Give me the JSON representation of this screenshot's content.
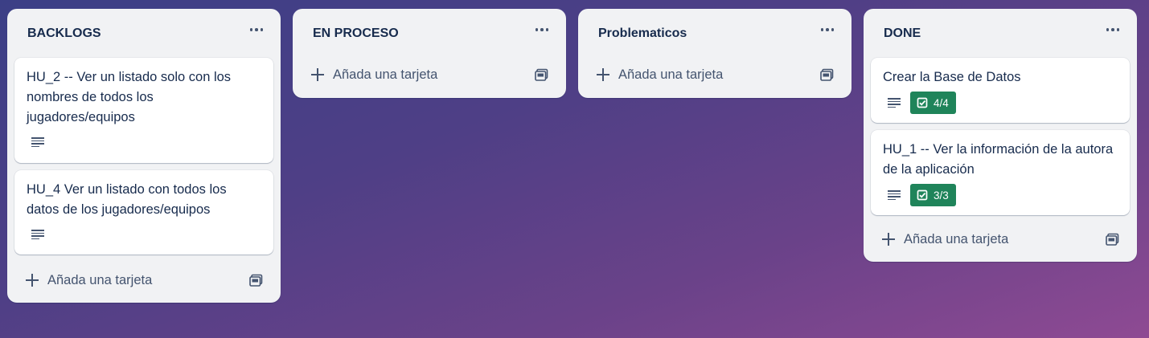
{
  "lists": [
    {
      "title": "BACKLOGS",
      "cards": [
        {
          "title": "HU_2 -- Ver un listado solo con los nombres de todos los jugadores/equipos",
          "has_description": true
        },
        {
          "title": "HU_4 Ver un listado con todos los datos de los jugadores/equipos",
          "has_description": true
        }
      ],
      "add_card_label": "Añada una tarjeta"
    },
    {
      "title": "EN PROCESO",
      "cards": [],
      "add_card_label": "Añada una tarjeta"
    },
    {
      "title": "Problematicos",
      "cards": [],
      "add_card_label": "Añada una tarjeta"
    },
    {
      "title": "DONE",
      "cards": [
        {
          "title": "Crear la Base de Datos",
          "has_description": true,
          "checklist": "4/4"
        },
        {
          "title": "HU_1 -- Ver la información de la autora de la aplicación",
          "has_description": true,
          "checklist": "3/3"
        }
      ],
      "add_card_label": "Añada una tarjeta"
    }
  ],
  "icons": {
    "list_menu": "more-horizontal-icon",
    "description": "description-lines-icon",
    "checklist": "checkbox-icon",
    "add": "plus-icon",
    "template": "card-template-icon"
  },
  "colors": {
    "checklist_complete": "#1f845a",
    "list_background": "#f1f2f4"
  }
}
